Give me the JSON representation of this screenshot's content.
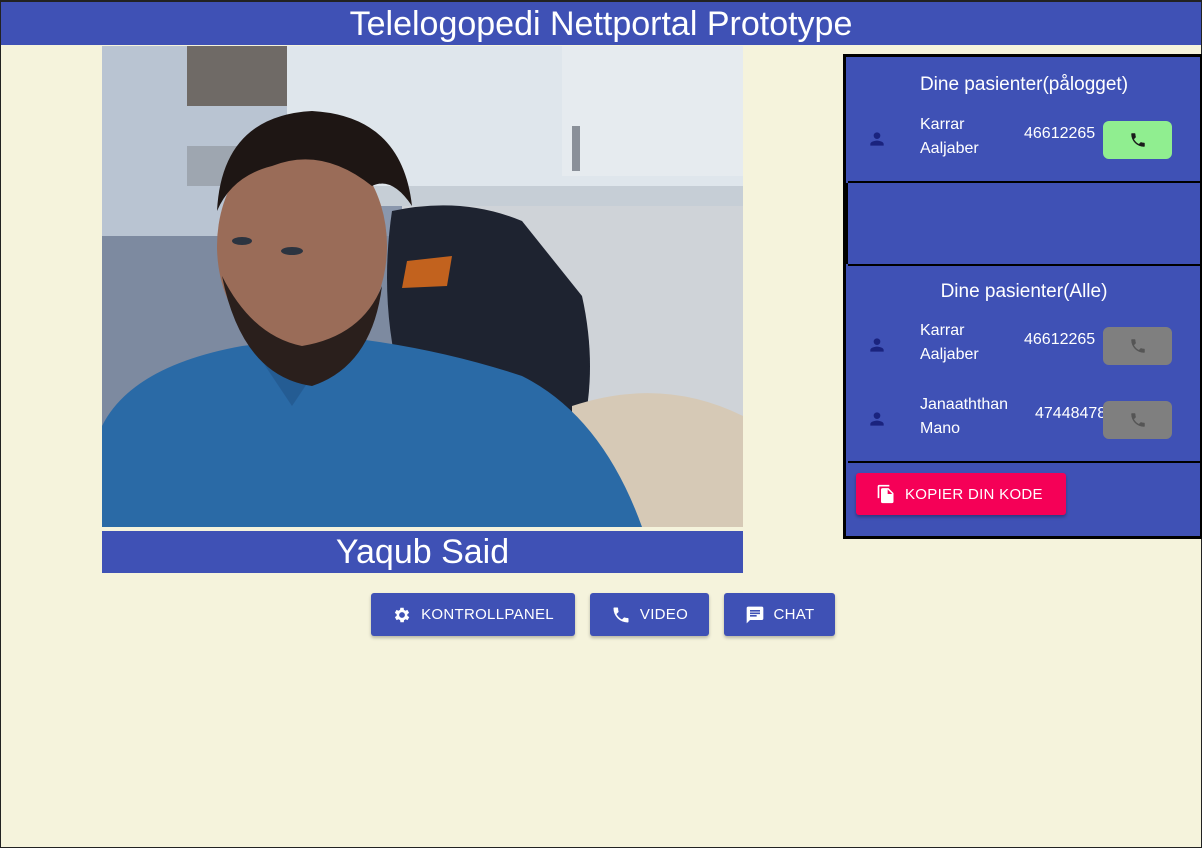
{
  "header": {
    "title": "Telelogopedi Nettportal Prototype"
  },
  "video": {
    "caller_name": "Yaqub Said"
  },
  "controls": {
    "control_panel_label": "KONTROLLPANEL",
    "video_label": "VIDEO",
    "chat_label": "CHAT"
  },
  "patients_online": {
    "title": "Dine pasienter(pålogget)",
    "rows": [
      {
        "name": "Karrar Aaljaber",
        "phone": "46612265",
        "call_enabled": true
      }
    ]
  },
  "patients_all": {
    "title": "Dine pasienter(Alle)",
    "rows": [
      {
        "name": "Karrar Aaljaber",
        "phone": "46612265",
        "call_enabled": false
      },
      {
        "name": "Janaaththan Mano",
        "phone": "47448478",
        "call_enabled": false
      }
    ]
  },
  "copy_code": {
    "label": "KOPIER DIN KODE"
  },
  "colors": {
    "primary": "#3f51b5",
    "accent": "#f50057",
    "background": "#f5f3dc",
    "call_active": "#90ee90",
    "call_inactive": "#7f7f7f"
  },
  "icons": {
    "control_panel": "gear-icon",
    "video": "phone-icon",
    "chat": "chat-icon",
    "patient": "person-icon",
    "call": "phone-icon",
    "copy": "copy-icon"
  }
}
